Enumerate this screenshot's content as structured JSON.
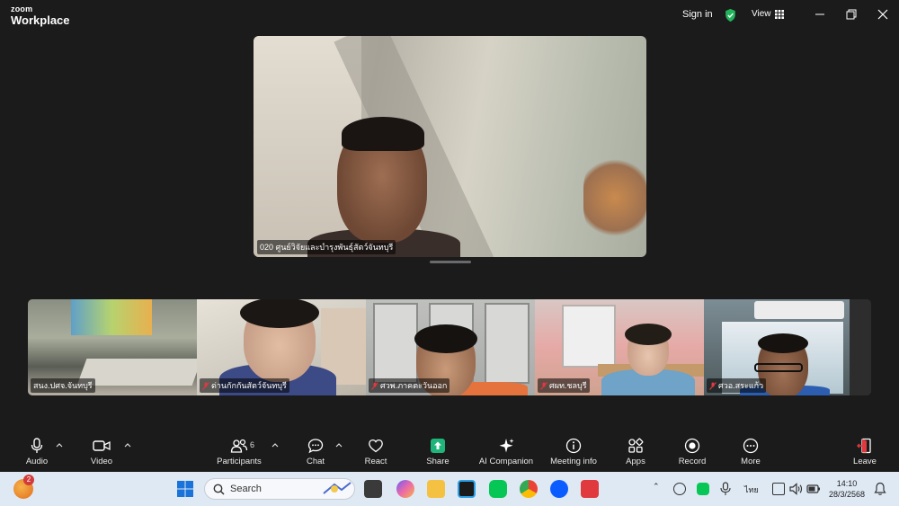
{
  "window": {
    "logo_top": "zoom",
    "logo_bottom": "Workplace",
    "sign_in": "Sign in",
    "view_label": "View"
  },
  "main_speaker": {
    "name": "020 ศูนย์วิจัยและบำรุงพันธุ์สัตว์จันทบุรี"
  },
  "thumbnails": [
    {
      "name": "สนง.ปศจ.จันทบุรี",
      "muted": false
    },
    {
      "name": "ด่านกักกันสัตว์จันทบุรี",
      "muted": true
    },
    {
      "name": "ศวพ.ภาคตะวันออก",
      "muted": true
    },
    {
      "name": "ศผท.ชลบุรี",
      "muted": true
    },
    {
      "name": "ศวอ.สระแก้ว",
      "muted": true
    }
  ],
  "toolbar": {
    "audio": "Audio",
    "video": "Video",
    "participants": "Participants",
    "participants_count": "6",
    "chat": "Chat",
    "react": "React",
    "share": "Share",
    "ai_companion": "AI Companion",
    "meeting_info": "Meeting info",
    "apps": "Apps",
    "record": "Record",
    "more": "More",
    "leave": "Leave"
  },
  "taskbar": {
    "search_placeholder": "Search",
    "notification_count": "2",
    "language": "ไทย",
    "time": "14:10",
    "date": "28/3/2568"
  },
  "colors": {
    "share_green": "#1fb57a",
    "leave_red": "#e0393e",
    "shield_green": "#23b35d",
    "zoom_blue": "#0b5cff"
  }
}
